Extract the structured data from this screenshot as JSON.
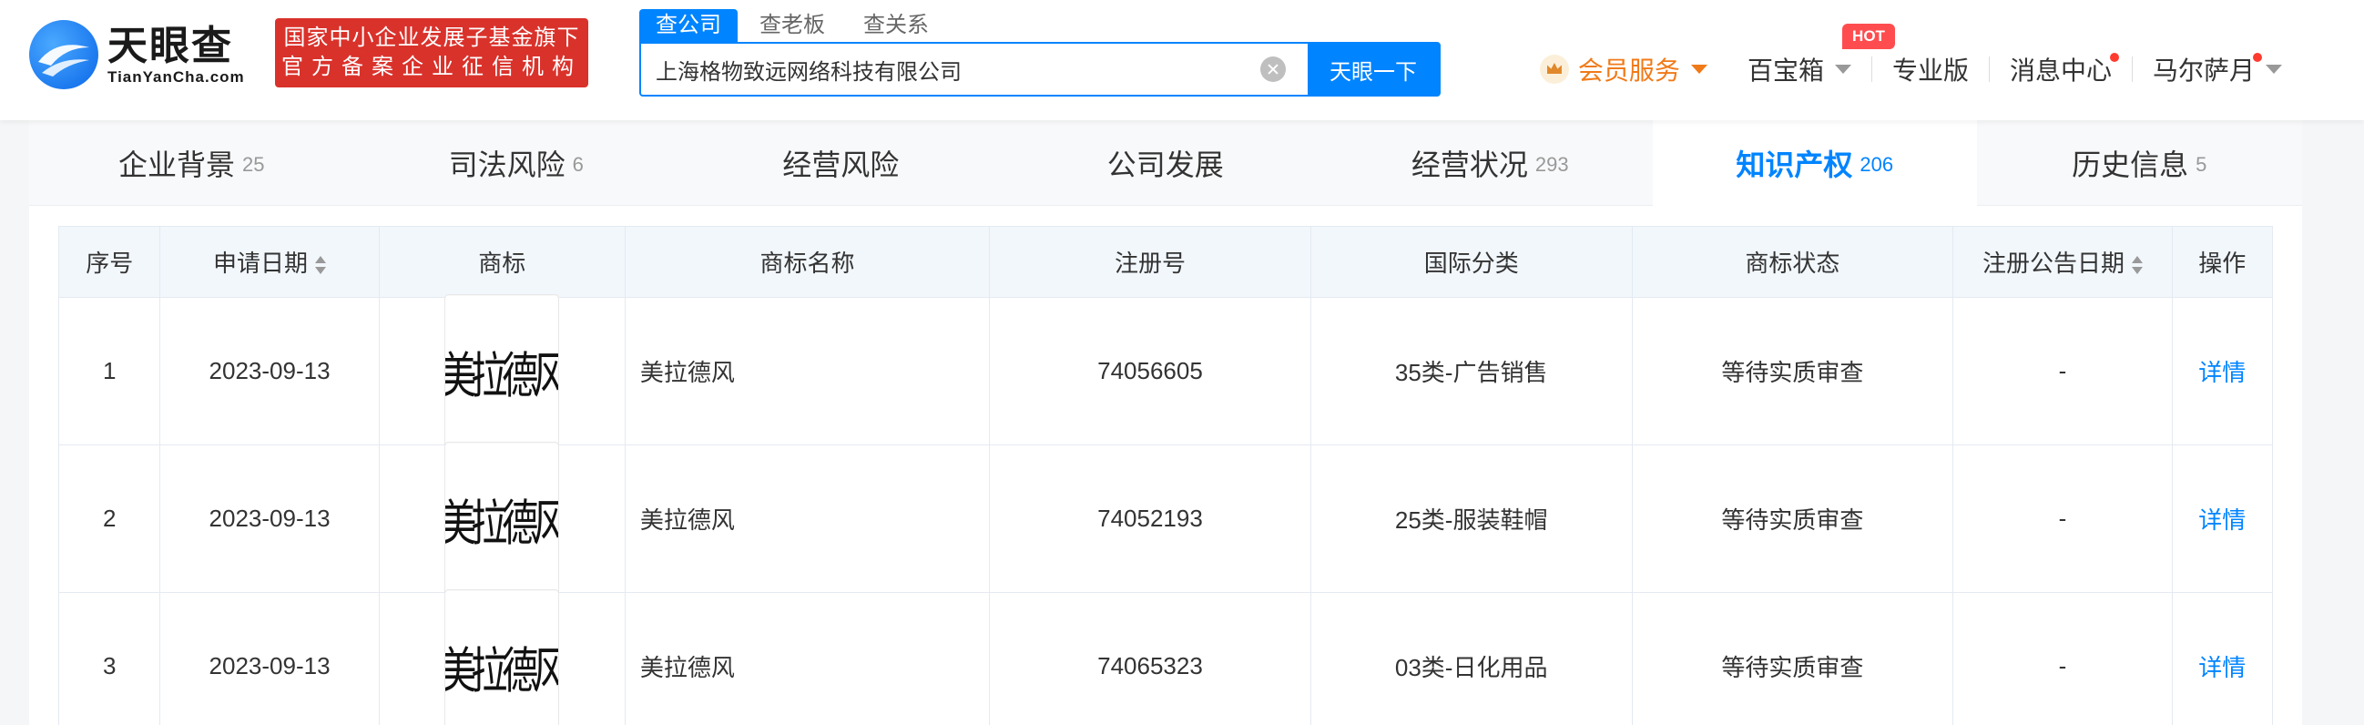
{
  "header": {
    "logo_cn": "天眼查",
    "logo_en": "TianYanCha.com",
    "badge_line1": "国家中小企业发展子基金旗下",
    "badge_line2": "官方备案企业征信机构",
    "search_tabs": [
      "查公司",
      "查老板",
      "查关系"
    ],
    "search_value": "上海格物致远网络科技有限公司",
    "search_button": "天眼一下",
    "nav": {
      "vip": "会员服务",
      "baibao": "百宝箱",
      "hot": "HOT",
      "pro": "专业版",
      "messages": "消息中心",
      "user": "马尔萨月"
    }
  },
  "section_tabs": [
    {
      "label": "企业背景",
      "count": "25"
    },
    {
      "label": "司法风险",
      "count": "6"
    },
    {
      "label": "经营风险",
      "count": ""
    },
    {
      "label": "公司发展",
      "count": ""
    },
    {
      "label": "经营状况",
      "count": "293"
    },
    {
      "label": "知识产权",
      "count": "206"
    },
    {
      "label": "历史信息",
      "count": "5"
    }
  ],
  "table": {
    "headers": [
      "序号",
      "申请日期",
      "商标",
      "商标名称",
      "注册号",
      "国际分类",
      "商标状态",
      "注册公告日期",
      "操作"
    ],
    "rows": [
      {
        "idx": "1",
        "date": "2023-09-13",
        "logo_text": "美拉德风",
        "name": "美拉德风",
        "reg_no": "74056605",
        "class": "35类-广告销售",
        "status": "等待实质审查",
        "pub_date": "-",
        "op": "详情"
      },
      {
        "idx": "2",
        "date": "2023-09-13",
        "logo_text": "美拉德风",
        "name": "美拉德风",
        "reg_no": "74052193",
        "class": "25类-服装鞋帽",
        "status": "等待实质审查",
        "pub_date": "-",
        "op": "详情"
      },
      {
        "idx": "3",
        "date": "2023-09-13",
        "logo_text": "美拉德风",
        "name": "美拉德风",
        "reg_no": "74065323",
        "class": "03类-日化用品",
        "status": "等待实质审查",
        "pub_date": "-",
        "op": "详情"
      }
    ]
  },
  "colors": {
    "accent": "#0084ff",
    "badge_red": "#d9322b",
    "vip_orange": "#f07a18"
  }
}
